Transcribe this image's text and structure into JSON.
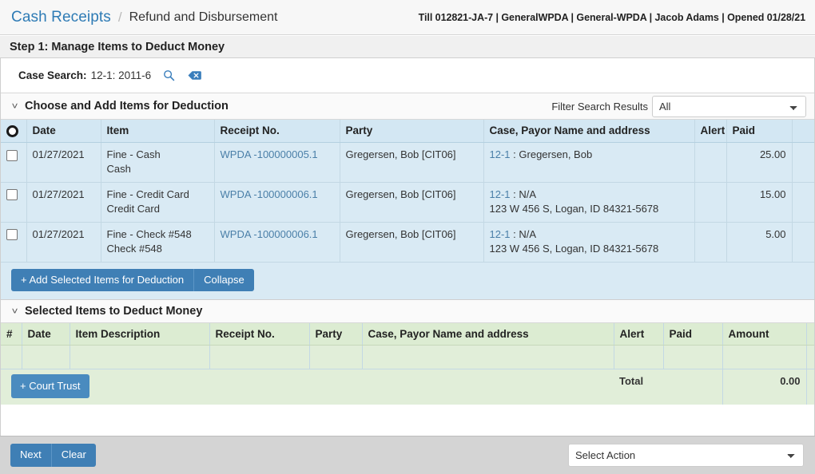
{
  "header": {
    "breadcrumb_main": "Cash Receipts",
    "breadcrumb_separator": "/",
    "breadcrumb_sub": "Refund and Disbursement",
    "till_info": "Till 012821-JA-7 | GeneralWPDA | General-WPDA | Jacob Adams | Opened 01/28/21"
  },
  "step": {
    "title": "Step 1: Manage Items to Deduct Money"
  },
  "case_search": {
    "label": "Case Search:",
    "value": "12-1: 2011-6",
    "search_icon": "search-icon",
    "clear_icon": "erase-icon"
  },
  "choose_section": {
    "chevron": "˅",
    "title": "Choose and Add Items for Deduction",
    "filter_label": "Filter Search Results",
    "filter_selected": "All",
    "filter_options": [
      "All"
    ],
    "columns": [
      "Date",
      "Item",
      "Receipt No.",
      "Party",
      "Case, Payor Name and address",
      "Alert",
      "Paid"
    ],
    "rows": [
      {
        "date": "01/27/2021",
        "item_line1": "Fine - Cash",
        "item_line2": "Cash",
        "receipt_no": "WPDA -100000005.1",
        "party": "Gregersen, Bob [CIT06]",
        "case_no": "12-1",
        "case_sep": ":",
        "payor": "Gregersen, Bob",
        "address": "",
        "alert": "",
        "paid": "25.00"
      },
      {
        "date": "01/27/2021",
        "item_line1": "Fine - Credit Card",
        "item_line2": "Credit Card",
        "receipt_no": "WPDA -100000006.1",
        "party": "Gregersen, Bob [CIT06]",
        "case_no": "12-1",
        "case_sep": ":",
        "payor": "N/A",
        "address": "123 W 456 S, Logan, ID 84321-5678",
        "alert": "",
        "paid": "15.00"
      },
      {
        "date": "01/27/2021",
        "item_line1": "Fine - Check #548",
        "item_line2": "Check #548",
        "receipt_no": "WPDA -100000006.1",
        "party": "Gregersen, Bob [CIT06]",
        "case_no": "12-1",
        "case_sep": ":",
        "payor": "N/A",
        "address": "123 W 456 S, Logan, ID 84321-5678",
        "alert": "",
        "paid": "5.00"
      }
    ],
    "add_button": "+ Add Selected Items for Deduction",
    "collapse_button": "Collapse"
  },
  "selected_section": {
    "chevron": "˅",
    "title": "Selected Items to Deduct Money",
    "columns": [
      "#",
      "Date",
      "Item Description",
      "Receipt No.",
      "Party",
      "Case, Payor Name and address",
      "Alert",
      "Paid",
      "Amount"
    ],
    "rows": [],
    "court_trust_button": "+ Court Trust",
    "total_label": "Total",
    "total_value": "0.00"
  },
  "footer": {
    "next_button": "Next",
    "clear_button": "Clear",
    "action_selected": "Select Action",
    "action_options": [
      "Select Action"
    ]
  },
  "colors": {
    "accent_blue": "#3f7fb5",
    "link_blue": "#4a7fa8",
    "table_blue_bg": "#d9eaf4",
    "table_green_bg": "#e1eed9",
    "footer_gray": "#d4d4d4"
  }
}
